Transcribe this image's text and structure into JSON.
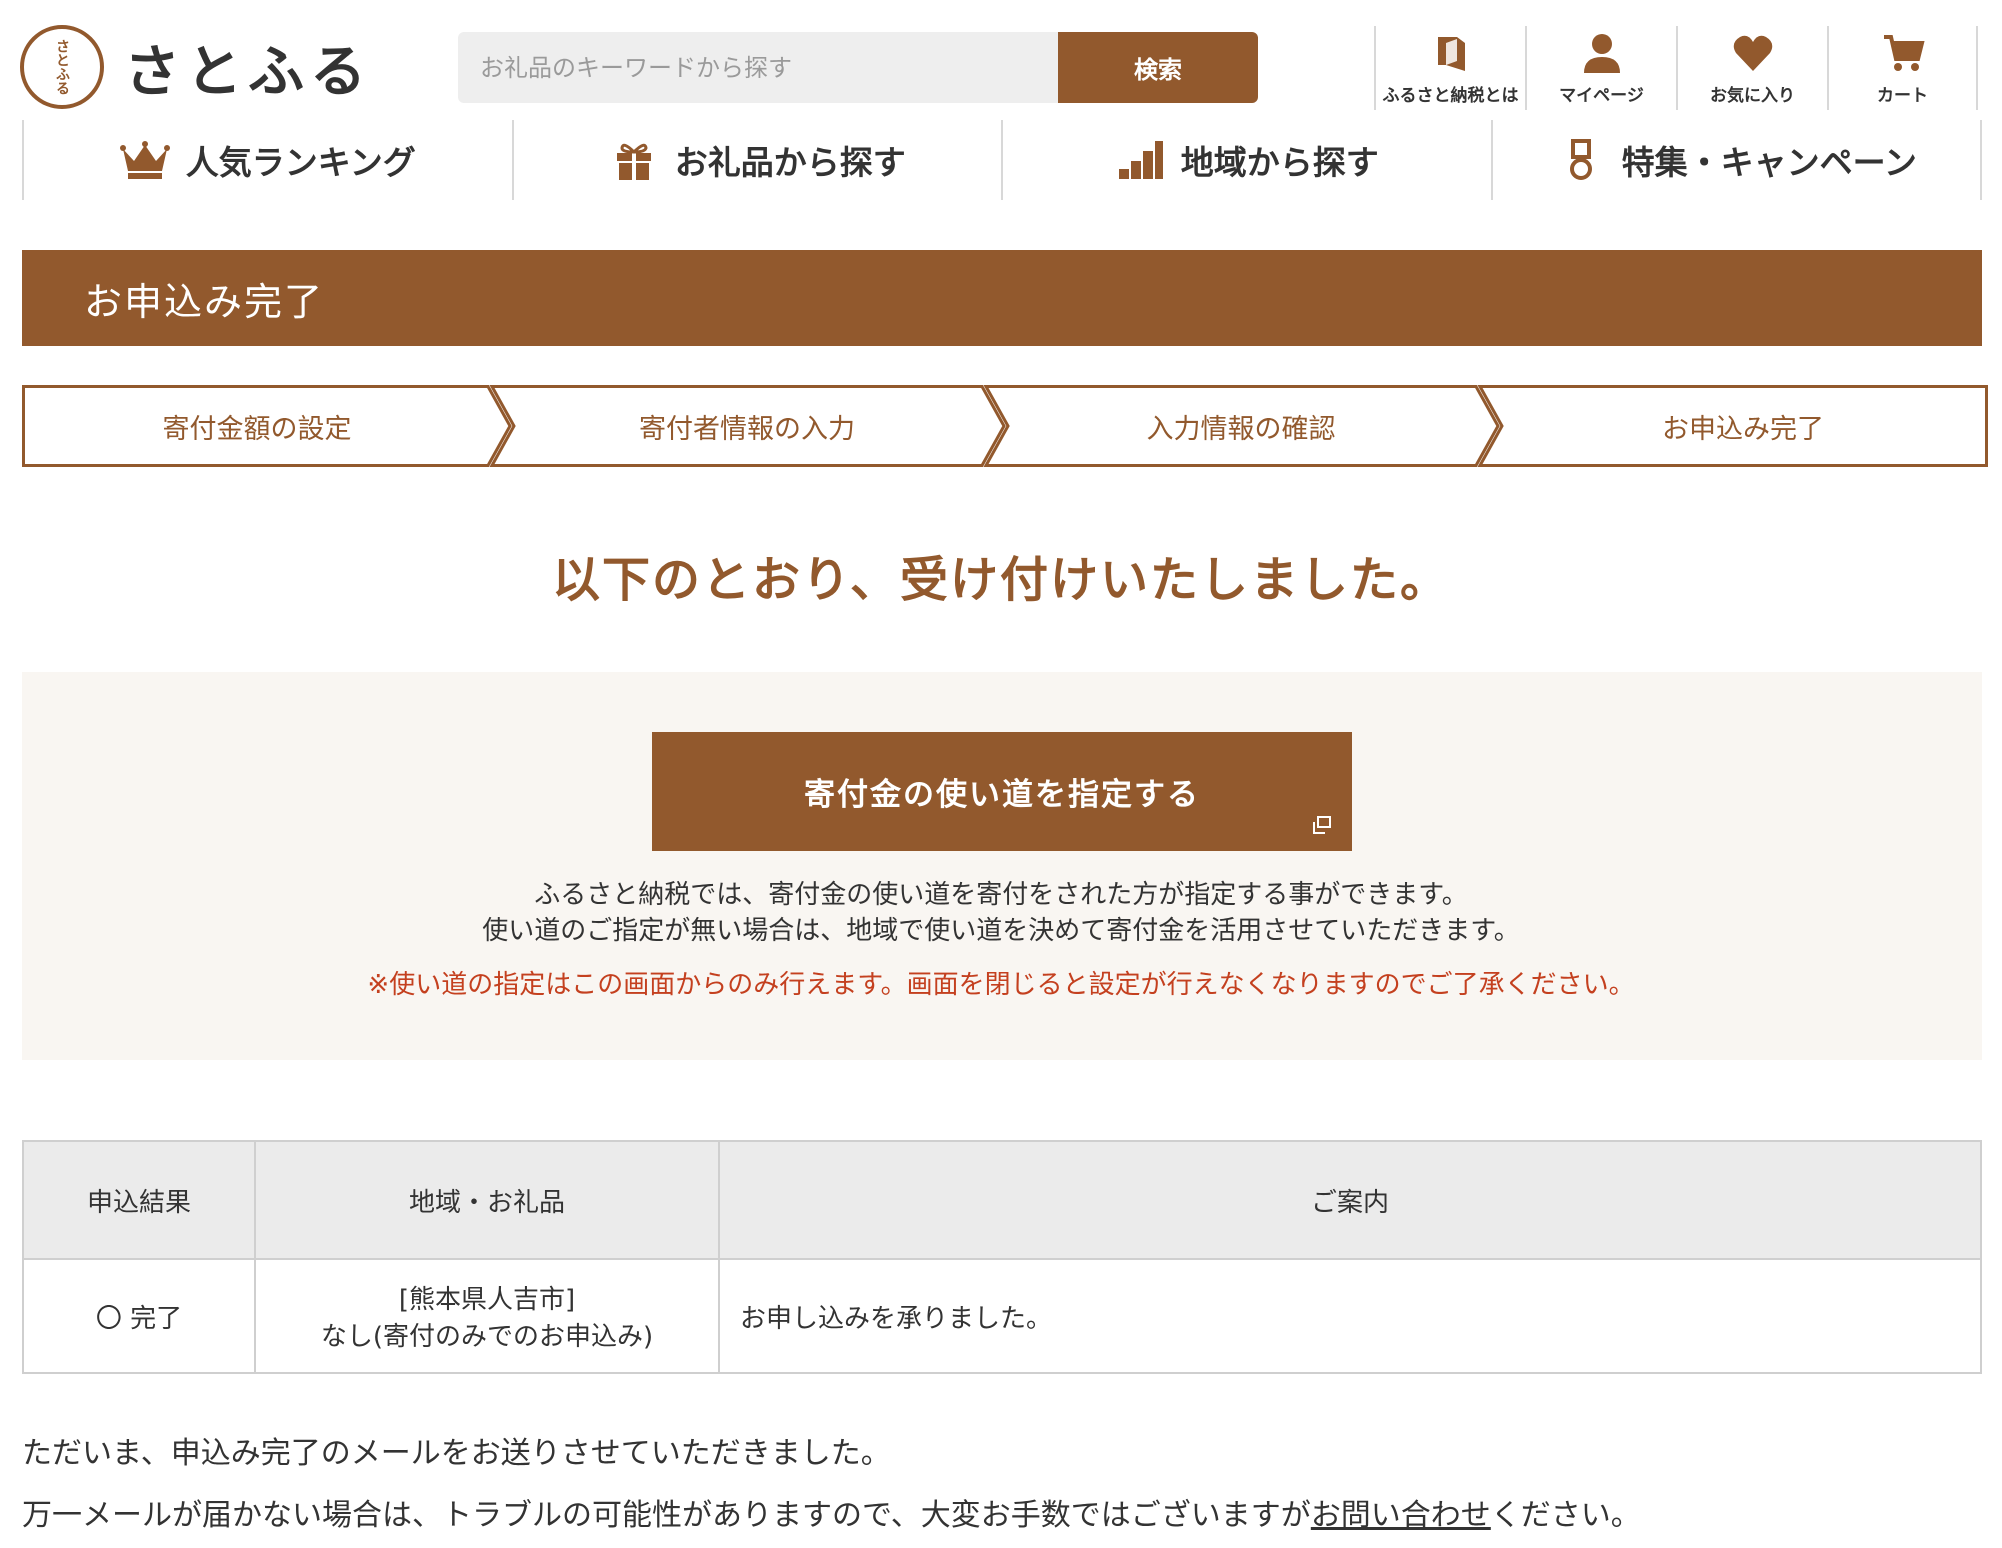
{
  "header": {
    "logo_mark": "さとふる",
    "logo_text": "さとふる",
    "search_placeholder": "お礼品のキーワードから探す",
    "search_button": "検索",
    "utility_links": [
      {
        "label": "ふるさと納税とは",
        "icon": "book-icon"
      },
      {
        "label": "マイページ",
        "icon": "user-icon"
      },
      {
        "label": "お気に入り",
        "icon": "heart-icon"
      },
      {
        "label": "カート",
        "icon": "cart-icon"
      }
    ]
  },
  "global_nav": [
    {
      "label": "人気ランキング",
      "icon": "crown-icon"
    },
    {
      "label": "お礼品から探す",
      "icon": "gift-icon"
    },
    {
      "label": "地域から探す",
      "icon": "region-icon"
    },
    {
      "label": "特集・キャンペーン",
      "icon": "medal-icon"
    }
  ],
  "page_title": "お申込み完了",
  "steps": [
    "寄付金額の設定",
    "寄付者情報の入力",
    "入力情報の確認",
    "お申込み完了"
  ],
  "headline": "以下のとおり、受け付けいたしました。",
  "usage": {
    "button": "寄付金の使い道を指定する",
    "note_line1": "ふるさと納税では、寄付金の使い道を寄付をされた方が指定する事ができます。",
    "note_line2": "使い道のご指定が無い場合は、地域で使い道を決めて寄付金を活用させていただきます。",
    "warning": "※使い道の指定はこの画面からのみ行えます。画面を閉じると設定が行えなくなりますのでご了承ください。"
  },
  "result_table": {
    "headers": [
      "申込結果",
      "地域・お礼品",
      "ご案内"
    ],
    "row": {
      "status": "〇 完了",
      "region": "[熊本県人吉市]",
      "item": "なし(寄付のみでのお申込み)",
      "info": "お申し込みを承りました。"
    }
  },
  "footer_text": {
    "line1": "ただいま、申込み完了のメールをお送りさせていただきました。",
    "line2_before": "万一メールが届かない場合は、トラブルの可能性がありますので、大変お手数ではございますが",
    "line2_link": "お問い合わせ",
    "line2_after": "ください。"
  },
  "colors": {
    "brand": "#92592d",
    "warning": "#c4401f",
    "panel_bg": "#f9f6f2"
  }
}
